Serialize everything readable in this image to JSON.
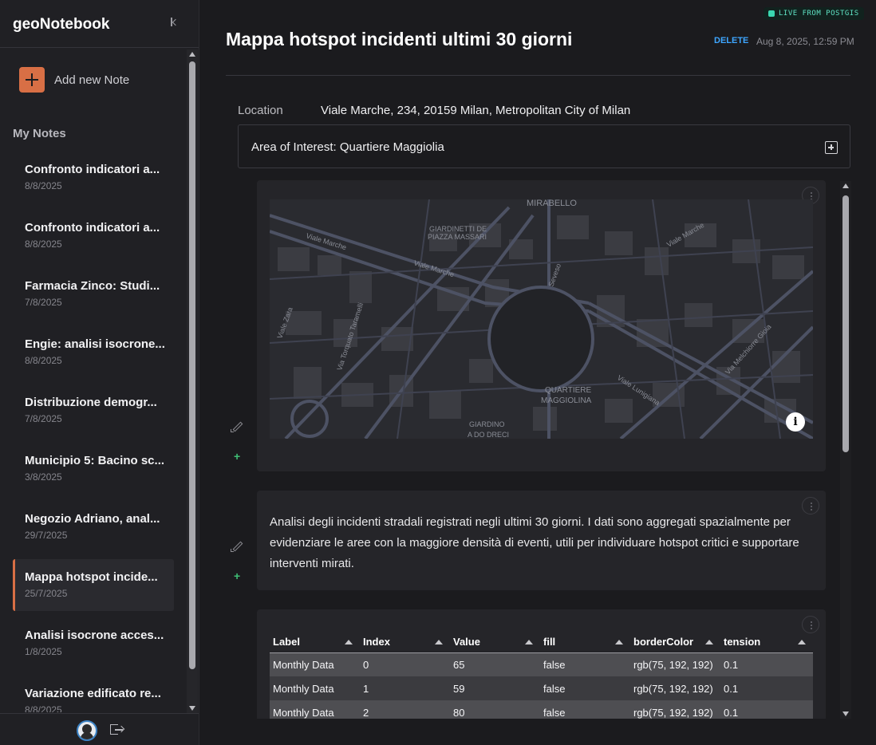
{
  "sidebar": {
    "brand": "geoNotebook",
    "add_note_label": "Add new Note",
    "section_title": "My Notes",
    "notes": [
      {
        "title": "Confronto indicatori a...",
        "date": "8/8/2025"
      },
      {
        "title": "Confronto indicatori a...",
        "date": "8/8/2025"
      },
      {
        "title": "Farmacia Zinco: Studi...",
        "date": "7/8/2025"
      },
      {
        "title": "Engie: analisi isocrone...",
        "date": "8/8/2025"
      },
      {
        "title": "Distribuzione demogr...",
        "date": "7/8/2025"
      },
      {
        "title": "Municipio 5: Bacino sc...",
        "date": "3/8/2025"
      },
      {
        "title": "Negozio Adriano, anal...",
        "date": "29/7/2025"
      },
      {
        "title": "Mappa hotspot incide...",
        "date": "25/7/2025",
        "active": true
      },
      {
        "title": "Analisi isocrone acces...",
        "date": "1/8/2025"
      },
      {
        "title": "Variazione edificato re...",
        "date": "8/8/2025"
      }
    ]
  },
  "header": {
    "live_badge": "LIVE FROM POSTGIS",
    "title": "Mappa hotspot incidenti ultimi 30 giorni",
    "delete_label": "DELETE",
    "timestamp": "Aug 8, 2025, 12:59 PM"
  },
  "location": {
    "label": "Location",
    "value": "Viale Marche, 234, 20159 Milan, Metropolitan City of Milan"
  },
  "area_of_interest": "Area of Interest: Quartiere Maggiolia",
  "map": {
    "labels": {
      "mirabello": "MIRABELLO",
      "giardinetti": "GIARDINETTI DE",
      "piazza": "PIAZZA MASSARI",
      "viale_marche_1": "Viale Marche",
      "viale_marche_2": "Viale Marche",
      "viale_marche_3": "Viale Marche",
      "seveso": "Seveso",
      "viale_zara": "Viale Zara",
      "via_taramelli": "Via Torquato Taramelli",
      "quartiere": "QUARTIERE",
      "maggiolina": "MAGGIOLINA",
      "lunigiana": "Viale Lunigiana",
      "melchiorre": "Via Melchiorre Gioia",
      "giardino": "GIARDINO",
      "giardino2": "A DO DRECI"
    },
    "info_glyph": "i"
  },
  "description": "Analisi degli incidenti stradali registrati negli ultimi 30 giorni. I dati sono aggregati spazialmente per evidenziare le aree con la maggiore densità di eventi, utili per individuare hotspot critici e supportare interventi mirati.",
  "table": {
    "columns": [
      "Label",
      "Index",
      "Value",
      "fill",
      "borderColor",
      "tension"
    ],
    "rows": [
      [
        "Monthly Data",
        "0",
        "65",
        "false",
        "rgb(75, 192, 192)",
        "0.1"
      ],
      [
        "Monthly Data",
        "1",
        "59",
        "false",
        "rgb(75, 192, 192)",
        "0.1"
      ],
      [
        "Monthly Data",
        "2",
        "80",
        "false",
        "rgb(75, 192, 192)",
        "0.1"
      ]
    ]
  },
  "colors": {
    "accent": "#d86f45",
    "link": "#3ea6ff",
    "live": "#3ad7b0",
    "add_block": "#3fbf75"
  }
}
